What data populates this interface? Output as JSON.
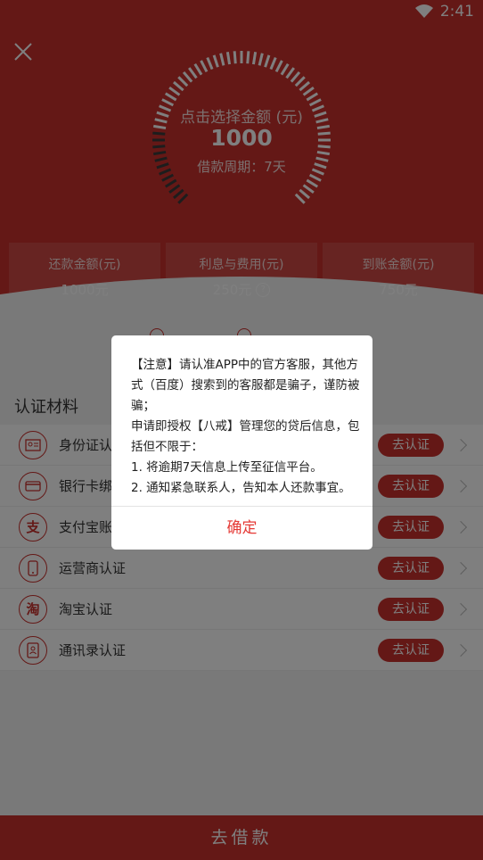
{
  "status_bar": {
    "time": "2:41",
    "wifi_icon": "wifi-icon"
  },
  "hero": {
    "select_amount_label": "点击选择金额 (元)",
    "amount": "1000",
    "period": "借款周期：7天",
    "stats": [
      {
        "label": "还款金额(元)",
        "value": "1000元"
      },
      {
        "label": "利息与费用(元)",
        "value": "250元"
      },
      {
        "label": "到账金额(元)",
        "value": "750元"
      }
    ]
  },
  "section_title": "认证材料",
  "auth_items": [
    {
      "label": "身份证认证",
      "icon": "id-card-icon",
      "glyph": "",
      "button": "去认证"
    },
    {
      "label": "银行卡绑定",
      "icon": "bank-card-icon",
      "glyph": "",
      "button": "去认证"
    },
    {
      "label": "支付宝账户",
      "icon": "alipay-icon",
      "glyph": "支",
      "button": "去认证"
    },
    {
      "label": "运营商认证",
      "icon": "phone-icon",
      "glyph": "",
      "button": "去认证"
    },
    {
      "label": "淘宝认证",
      "icon": "taobao-icon",
      "glyph": "淘",
      "button": "去认证"
    },
    {
      "label": "通讯录认证",
      "icon": "contacts-icon",
      "glyph": "",
      "button": "去认证"
    }
  ],
  "bottom_button": "去借款",
  "dialog": {
    "line1": "【注意】请认准APP中的官方客服，其他方式（百度）搜索到的客服都是骗子，谨防被骗；",
    "line2": "申请即授权【八戒】管理您的贷后信息，包括但不限于：",
    "line3": "1. 将逾期7天信息上传至征信平台。",
    "line4": "2. 通知紧急联系人，告知本人还款事宜。",
    "confirm": "确定"
  },
  "colors": {
    "brand": "#c9302c",
    "confirm_text": "#e53935"
  }
}
